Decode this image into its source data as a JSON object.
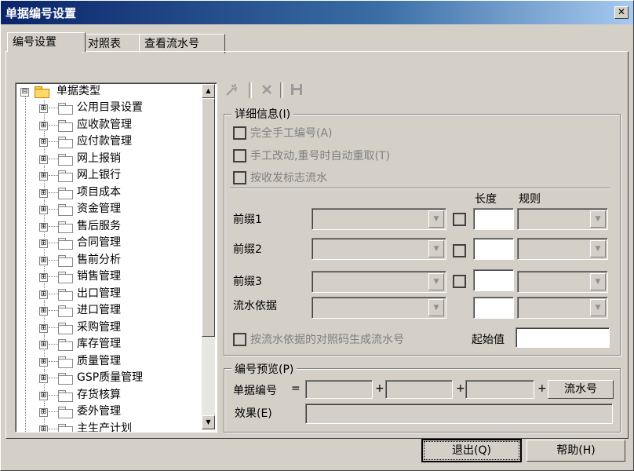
{
  "window": {
    "title": "单据编号设置",
    "close_glyph": "✕"
  },
  "tabs": [
    {
      "label": "编号设置",
      "active": true
    },
    {
      "label": "对照表",
      "active": false
    },
    {
      "label": "查看流水号",
      "active": false
    }
  ],
  "tree": {
    "root": {
      "label": "单据类型",
      "expander": "⊟"
    },
    "items": [
      "公用目录设置",
      "应收款管理",
      "应付款管理",
      "网上报销",
      "网上银行",
      "项目成本",
      "资金管理",
      "售后服务",
      "合同管理",
      "售前分析",
      "销售管理",
      "出口管理",
      "进口管理",
      "采购管理",
      "库存管理",
      "质量管理",
      "GSP质量管理",
      "存货核算",
      "委外管理",
      "主生产计划"
    ],
    "item_expander": "⊞"
  },
  "toolbar": {
    "new_icon": "new-icon",
    "delete_icon": "delete-icon",
    "save_icon": "save-icon"
  },
  "details": {
    "title": "详细信息(I)",
    "checkboxes": {
      "manual": "完全手工编号(A)",
      "renumber": "手工改动,重号时自动重取(T)",
      "by_flag": "按收发标志流水"
    },
    "col_length": "长度",
    "col_rule": "规则",
    "rows": {
      "prefix1": "前缀1",
      "prefix2": "前缀2",
      "prefix3": "前缀3",
      "serial_basis": "流水依据"
    },
    "gen_checkbox": "按流水依据的对照码生成流水号",
    "start_label": "起始值"
  },
  "preview": {
    "title": "编号预览(P)",
    "doc_number_label": "单据编号",
    "equals": "=",
    "plus": "+",
    "serial_button": "流水号",
    "effect_label": "效果(E)"
  },
  "buttons": {
    "exit": "退出(Q)",
    "help": "帮助(H)"
  }
}
